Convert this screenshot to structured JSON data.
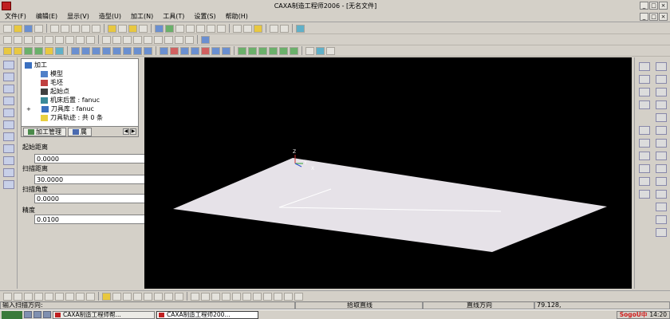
{
  "window": {
    "title": "CAXA制造工程师2006 - [无名文件]"
  },
  "menu": [
    "文件(F)",
    "编辑(E)",
    "显示(V)",
    "造型(U)",
    "加工(N)",
    "工具(T)",
    "设置(S)",
    "帮助(H)"
  ],
  "tree": {
    "root": "加工",
    "items": [
      "模型",
      "毛坯",
      "起始点",
      "机床后置 : fanuc",
      "刀具库 : fanuc",
      "刀具轨迹 : 共 0 条"
    ]
  },
  "tabs": {
    "manage": "加工管理",
    "props": "属"
  },
  "params": [
    {
      "label": "起始距离",
      "value": "0.0000"
    },
    {
      "label": "扫描距离",
      "value": "30.0000"
    },
    {
      "label": "扫描角度",
      "value": "0.0000"
    },
    {
      "label": "精度",
      "value": "0.0100"
    }
  ],
  "axis": {
    "z": "Z",
    "y": "Y",
    "x": "X"
  },
  "status": {
    "prompt": "输入扫描方向:",
    "mode": "拾取直线",
    "dir": "直线方向",
    "coords": "79.128,"
  },
  "taskbar": {
    "task1": "CAXA制造工程师帮...",
    "task2": "CAXA制造工程师200...",
    "ime": "SogoU中",
    "time": "14:20"
  }
}
